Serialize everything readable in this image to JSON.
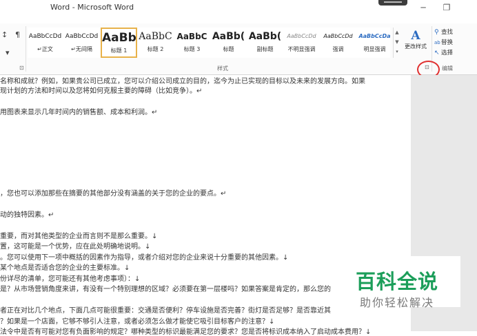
{
  "window": {
    "title": "Word - Microsoft Word",
    "minimize_glyph": "─",
    "restore_glyph": "❐"
  },
  "ribbon": {
    "paragraph_tools": {
      "sort": "↕",
      "pilcrow": "¶",
      "dropdown": "▾"
    },
    "styles": [
      {
        "preview": "AaBbCcDd",
        "name": "↵正文"
      },
      {
        "preview": "AaBbCcDd",
        "name": "↵无间隔"
      },
      {
        "preview": "AaBb",
        "name": "标题 1"
      },
      {
        "preview": "AaBbC",
        "name": "标题 2"
      },
      {
        "preview": "AaBbC",
        "name": "标题 3"
      },
      {
        "preview": "AaBb(",
        "name": "标题"
      },
      {
        "preview": "AaBb(",
        "name": "副标题"
      },
      {
        "preview": "AaBbCcDd",
        "name": "不明显强调"
      },
      {
        "preview": "AaBbCcDd",
        "name": "强调"
      },
      {
        "preview": "AaBbCcDa",
        "name": "明显强调"
      }
    ],
    "gallery_scroll": [
      "▲",
      "▼",
      "▾"
    ],
    "change_styles": {
      "icon": "A",
      "label": "更改样式"
    },
    "editing": {
      "find": "查找",
      "replace": "替换",
      "select": "选择",
      "find_icon": "⚲",
      "replace_icon": "ab",
      "select_icon": "↖"
    },
    "group_labels": {
      "paragraph_launcher": "⊡",
      "styles": "样式",
      "styles_launcher": "⊡",
      "editing": "编辑"
    }
  },
  "document": {
    "lines": [
      "名称和成就？例如，如果贵公司已成立，您可以介绍公司成立的目的，迄今为止已实现的目标以及未来的发展方向。如果",
      "现计划的方法和时间以及您将如何克服主要的障碍（比如竞争）。↵",
      "用图表来显示几年时间内的销售额、成本和利润。↵",
      "，您也可以添加那些在摘要的其他部分没有涵盖的关于您的企业的要点。↵",
      "动的独特因素。↵",
      "重要，而对其他类型的企业而言则不是那么重要。↓",
      "置，这可能是一个优势，应在此处明确地说明。↓",
      "。您可以使用下一项中概括的因素作为指导，或者介绍对您的企业来说十分重要的其他因素。↓",
      "某个地点是否适合您的企业的主要标准。↓",
      "份详尽的清单，您可能还有其他考虑事项）：↓",
      "是？从市场营销角度来讲，有没有一个特别理想的区域？必须要在第一层楼吗？如果答案是肯定的，那么您的",
      "者正在对比几个地点，下面几点可能很重要：交通是否便利？停车设施是否完善？街灯是否足够？是否靠近其",
      "？如果是一个店面，它够不够引人注意，或者必须怎么做才能使它吸引目标客户的注意？↓",
      "法令中是否有可能对您有负面影响的规定？哪种类型的标识最能满足您的要求？您是否将标识成本纳入了启动成本费用？↓"
    ]
  },
  "watermark": {
    "logo": "百科全说",
    "subtitle": "助你轻松解决"
  }
}
